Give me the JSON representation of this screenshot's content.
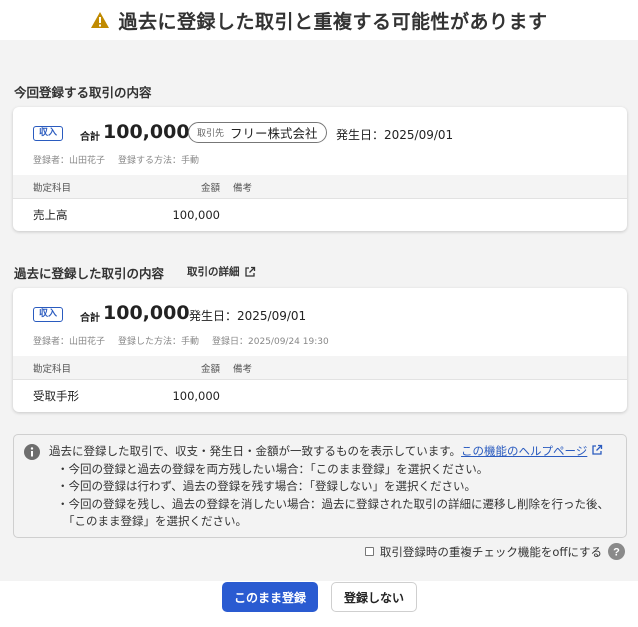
{
  "dialog": {
    "title": "過去に登録した取引と重複する可能性があります",
    "warning_icon": "warning-triangle-icon"
  },
  "current_section": {
    "title": "今回登録する取引の内容",
    "card": {
      "badge": "収入",
      "total_label": "合計",
      "total_amount": "100,000",
      "partner_tag": "取引先",
      "partner_name": "フリー株式会社",
      "issue_date": "発生日：2025/09/01",
      "registrant": "登録者：山田花子",
      "method": "登録する方法：手動",
      "table_headers": {
        "account": "勘定科目",
        "amount": "金額",
        "note": "備考"
      },
      "rows": [
        {
          "account": "売上高",
          "amount": "100,000",
          "note": ""
        }
      ]
    }
  },
  "past_section": {
    "title": "過去に登録した取引の内容",
    "detail_link": "取引の詳細",
    "card": {
      "badge": "収入",
      "total_label": "合計",
      "total_amount": "100,000",
      "issue_date": "発生日：2025/09/01",
      "registrant": "登録者：山田花子",
      "method": "登録した方法：手動",
      "registered_at": "登録日：2025/09/24 19:30",
      "table_headers": {
        "account": "勘定科目",
        "amount": "金額",
        "note": "備考"
      },
      "rows": [
        {
          "account": "受取手形",
          "amount": "100,000",
          "note": ""
        }
      ]
    }
  },
  "notice": {
    "intro": "過去に登録した取引で、収支・発生日・金額が一致するものを表示しています。",
    "help_link": "この機能のヘルプページ",
    "bullet_1": "・今回の登録と過去の登録を両方残したい場合：「このまま登録」を選択ください。",
    "bullet_2": "・今回の登録は行わず、過去の登録を残す場合：「登録しない」を選択ください。",
    "bullet_3": "・今回の登録を残し、過去の登録を消したい場合：過去に登録された取引の詳細に遷移し削除を行った後、",
    "bullet_3_cont": "「このまま登録」を選択ください。"
  },
  "dup_check": {
    "label": "取引登録時の重複チェック機能をoffにする",
    "checked": false
  },
  "buttons": {
    "register": "このまま登録",
    "skip": "登録しない"
  },
  "colors": {
    "accent": "#2a5bd1",
    "badge": "#2a5bbf",
    "warning": "#c08a00",
    "background": "#f3f3f3"
  }
}
